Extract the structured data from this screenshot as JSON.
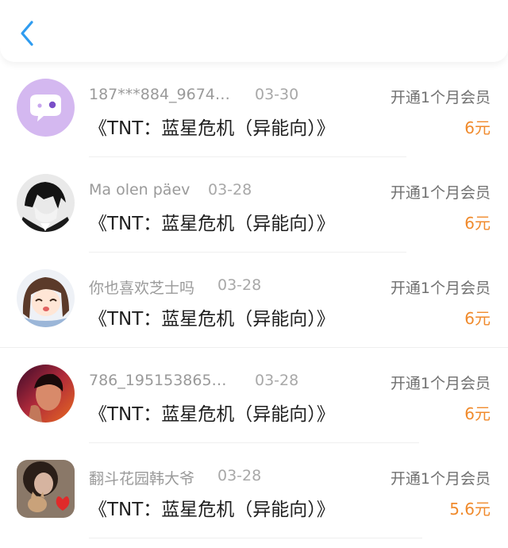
{
  "header": {
    "back_icon": "chevron-left-icon",
    "accent": "#2f9cf0"
  },
  "items": [
    {
      "username": "187***884_9674…",
      "date": "03-30",
      "title": "《TNT：蓝星危机（异能向）》",
      "action": "开通1个月会员",
      "price": "6元",
      "avatar": "chat-bubble-icon"
    },
    {
      "username": "Ma olen päev",
      "date": "03-28",
      "title": "《TNT：蓝星危机（异能向）》",
      "action": "开通1个月会员",
      "price": "6元",
      "avatar": "anime-boy-avatar"
    },
    {
      "username": "你也喜欢芝士吗",
      "date": "03-28",
      "title": "《TNT：蓝星危机（异能向）》",
      "action": "开通1个月会员",
      "price": "6元",
      "avatar": "anime-girl-avatar"
    },
    {
      "username": "786_195153865…",
      "date": "03-28",
      "title": "《TNT：蓝星危机（异能向）》",
      "action": "开通1个月会员",
      "price": "6元",
      "avatar": "photo-avatar"
    },
    {
      "username": "翻斗花园韩大爷",
      "date": "03-28",
      "title": "《TNT：蓝星危机（异能向）》",
      "action": "开通1个月会员",
      "price": "5.6元",
      "avatar": "cat-photo-avatar"
    }
  ],
  "colors": {
    "price": "#f08a2c",
    "username": "#9a9a9a",
    "title": "#1f1f1f"
  }
}
